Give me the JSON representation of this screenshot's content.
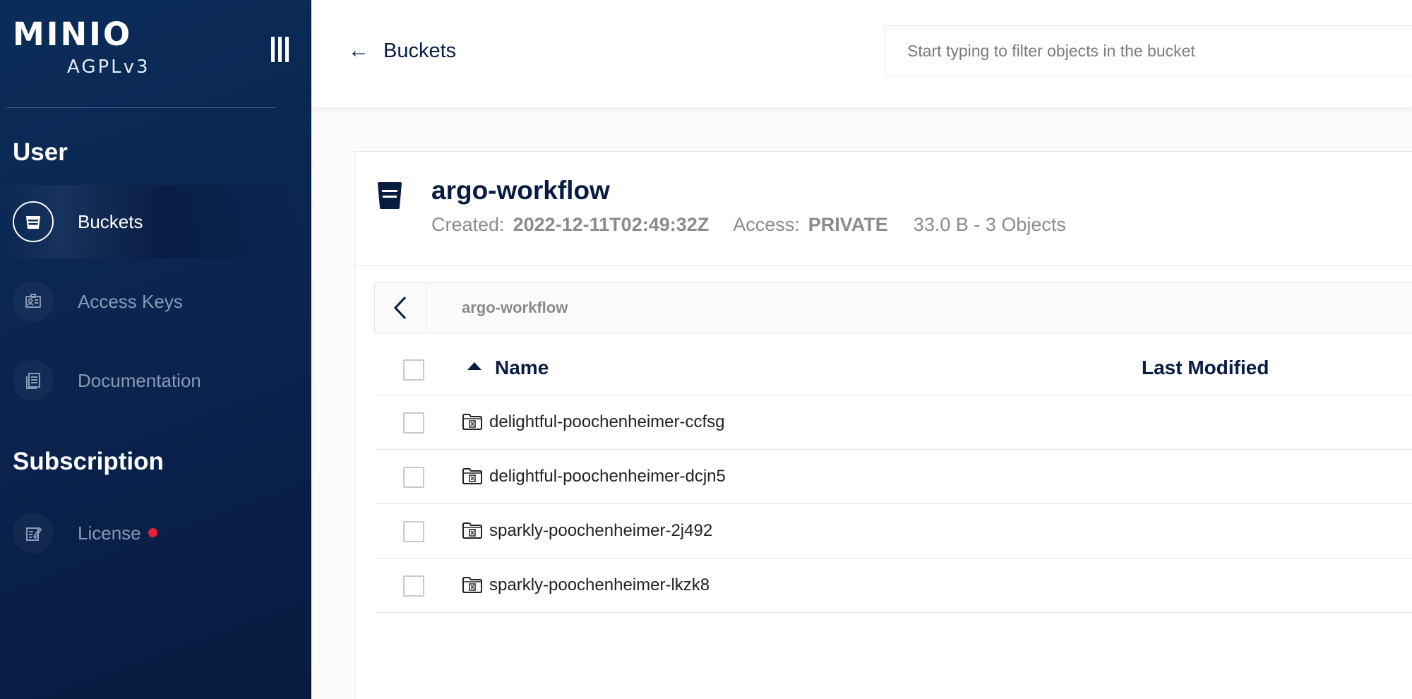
{
  "sidebar": {
    "logo_text": "MINIO",
    "license_label": "AGPLv3",
    "sections": [
      {
        "title": "User"
      },
      {
        "title": "Subscription"
      }
    ],
    "items": [
      {
        "label": "Buckets",
        "icon": "bucket-icon",
        "active": true
      },
      {
        "label": "Access Keys",
        "icon": "id-card-icon",
        "active": false
      },
      {
        "label": "Documentation",
        "icon": "docs-icon",
        "active": false
      },
      {
        "label": "License",
        "icon": "license-icon",
        "active": false,
        "alert": true
      }
    ]
  },
  "topbar": {
    "back_label": "Buckets",
    "search_placeholder": "Start typing to filter objects in the bucket"
  },
  "bucket": {
    "name": "argo-workflow",
    "created_label": "Created:",
    "created_value": "2022-12-11T02:49:32Z",
    "access_label": "Access:",
    "access_value": "PRIVATE",
    "usage": "33.0 B - 3 Objects"
  },
  "breadcrumb": {
    "path": "argo-workflow"
  },
  "table": {
    "columns": {
      "name": "Name",
      "last_modified": "Last Modified"
    },
    "sort": "ascending",
    "rows": [
      {
        "name": "delightful-poochenheimer-ccfsg",
        "type": "folder"
      },
      {
        "name": "delightful-poochenheimer-dcjn5",
        "type": "folder"
      },
      {
        "name": "sparkly-poochenheimer-2j492",
        "type": "folder"
      },
      {
        "name": "sparkly-poochenheimer-lkzk8",
        "type": "folder"
      }
    ]
  },
  "colors": {
    "sidebar_bg": "#0a2550",
    "text_primary": "#081c42",
    "alert": "#e3213c"
  }
}
